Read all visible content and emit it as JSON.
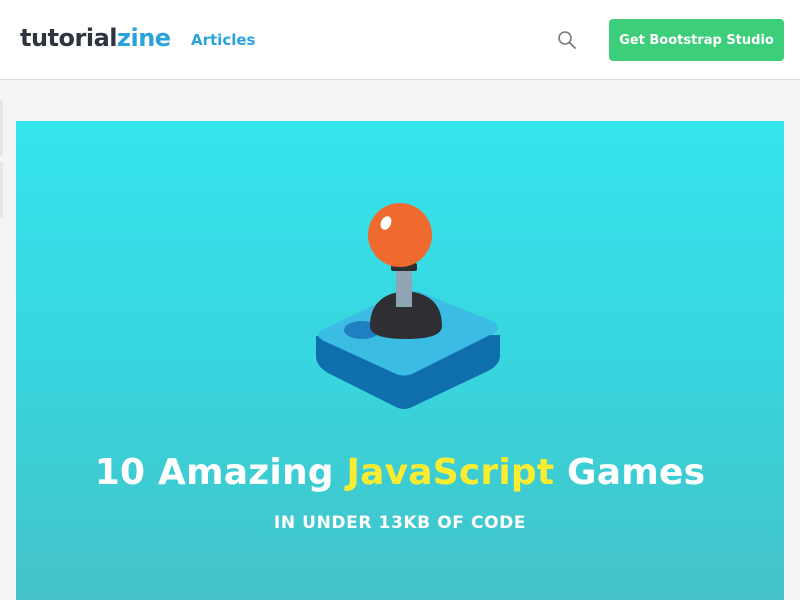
{
  "header": {
    "logo_part1": "tutorial",
    "logo_part2": "zine",
    "nav": [
      {
        "label": "Articles"
      }
    ],
    "search_icon": "search-icon",
    "cta_label": "Get Bootstrap Studio"
  },
  "hero": {
    "title_part1": "10 Amazing ",
    "title_highlight": "JavaScript",
    "title_part2": " Games",
    "subtitle": "IN UNDER 13KB OF CODE",
    "image_icon": "joystick-icon"
  },
  "colors": {
    "brand_blue": "#2aa3dc",
    "cta_green": "#3cce7a",
    "hero_cyan": "#34e4ec",
    "title_highlight": "#f9ec31",
    "joystick_ball": "#ee6a2e",
    "joystick_base": "#1f7fc0"
  }
}
